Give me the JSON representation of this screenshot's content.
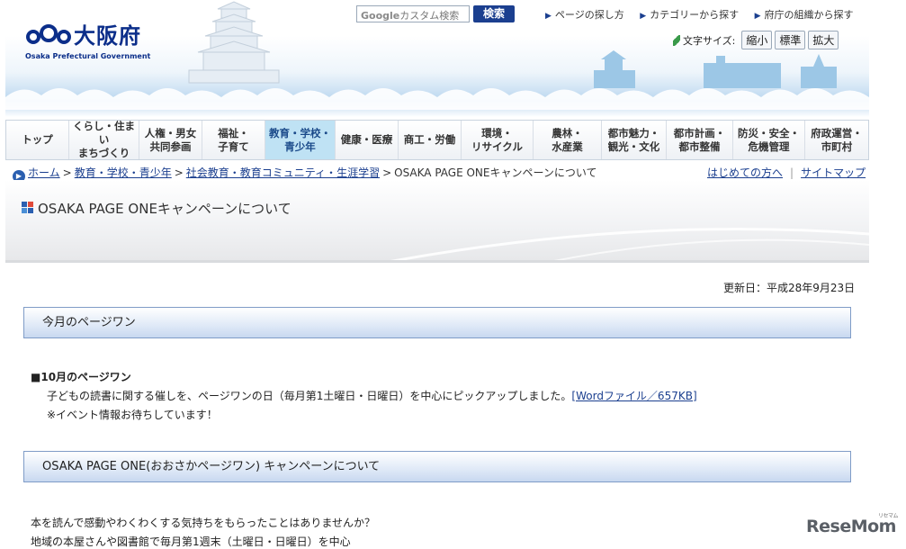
{
  "header": {
    "logo_name": "大阪府",
    "logo_sub": "Osaka Prefectural Government",
    "search_placeholder_brand": "Google",
    "search_placeholder_text": "カスタム検索",
    "search_button": "検索",
    "top_links": [
      "ページの探し方",
      "カテゴリーから探す",
      "府庁の組織から探す"
    ],
    "font_size_label": "文字サイズ:",
    "font_size_buttons": [
      "縮小",
      "標準",
      "拡大"
    ]
  },
  "nav": {
    "items": [
      {
        "line1": "トップ",
        "line2": ""
      },
      {
        "line1": "くらし・住まい",
        "line2": "まちづくり"
      },
      {
        "line1": "人権・男女",
        "line2": "共同参画"
      },
      {
        "line1": "福祉・",
        "line2": "子育て"
      },
      {
        "line1": "教育・学校・",
        "line2": "青少年"
      },
      {
        "line1": "健康・医療",
        "line2": ""
      },
      {
        "line1": "商工・労働",
        "line2": ""
      },
      {
        "line1": "環境・",
        "line2": "リサイクル"
      },
      {
        "line1": "農林・",
        "line2": "水産業"
      },
      {
        "line1": "都市魅力・",
        "line2": "観光・文化"
      },
      {
        "line1": "都市計画・",
        "line2": "都市整備"
      },
      {
        "line1": "防災・安全・",
        "line2": "危機管理"
      },
      {
        "line1": "府政運営・",
        "line2": "市町村"
      }
    ],
    "active_index": 4
  },
  "breadcrumb": {
    "home": "ホーム",
    "level1": "教育・学校・青少年",
    "level2": "社会教育・教育コミュニティ・生涯学習",
    "current": "OSAKA PAGE ONEキャンペーンについて",
    "separator": ">"
  },
  "right_links": [
    "はじめての方へ",
    "サイトマップ"
  ],
  "page_title": "OSAKA PAGE ONEキャンペーンについて",
  "updated": "更新日：平成28年9月23日",
  "section1": {
    "heading": "今月のページワン",
    "subheading": "■10月のページワン",
    "paragraph": "子どもの読書に関する催しを、ページワンの日（毎月第1土曜日・日曜日）を中心にピックアップしました。",
    "link": "[Wordファイル／657KB]",
    "note": "※イベント情報お待ちしています！"
  },
  "section2": {
    "heading": "OSAKA PAGE ONE(おおさかページワン) キャンペーンについて",
    "lines": [
      "本を読んで感動やわくわくする気持ちをもらったことはありませんか？",
      "地域の本屋さんや図書館で毎月第1週末（土曜日・日曜日）を中心"
    ]
  },
  "watermark": {
    "text": "ReseMom",
    "small": "リセマム"
  },
  "colors": {
    "brand_blue": "#0b2e8a",
    "nav_active": "#bfe2f4",
    "link": "#1b3f8f",
    "section_border": "#7f9cc7"
  }
}
